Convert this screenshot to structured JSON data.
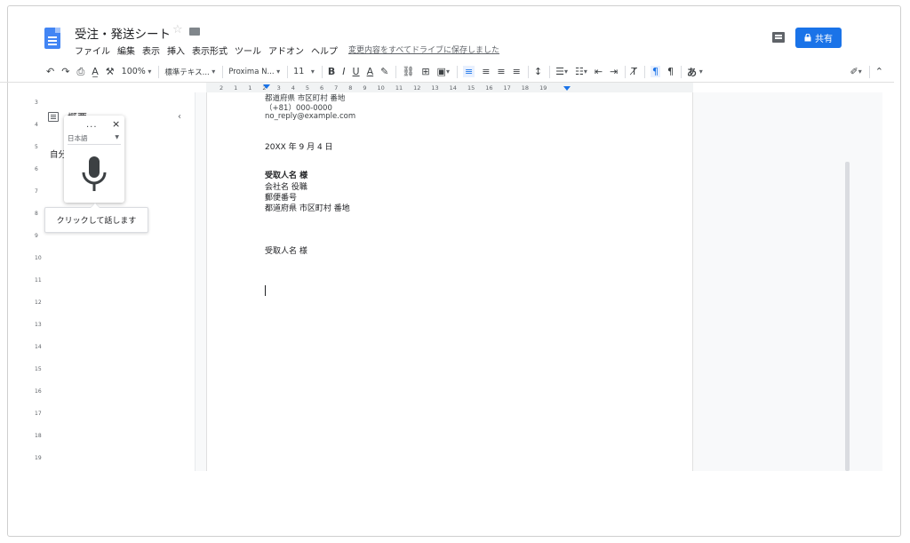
{
  "header": {
    "doc_title": "受注・発送シート",
    "menu": [
      "ファイル",
      "編集",
      "表示",
      "挿入",
      "表示形式",
      "ツール",
      "アドオン",
      "ヘルプ"
    ],
    "save_status": "変更内容をすべてドライブに保存しました",
    "share_label": "共有",
    "share_icon": "lock-icon",
    "colors": {
      "brand_blue": "#1a73e8",
      "doc_blue": "#4285f4"
    }
  },
  "toolbar": {
    "zoom": "100%",
    "style": "標準テキス...",
    "font": "Proxima N...",
    "font_size": "11",
    "bold": "B",
    "italic": "I",
    "underline": "U",
    "text_color": "A",
    "input_tool": "あ"
  },
  "ruler": {
    "marks": [
      "2",
      "1",
      "1",
      "2",
      "3",
      "4",
      "5",
      "6",
      "7",
      "8",
      "9",
      "10",
      "11",
      "12",
      "13",
      "14",
      "15",
      "16",
      "17",
      "18",
      "19"
    ]
  },
  "vertical_ruler": {
    "marks": [
      "3",
      "4",
      "5",
      "6",
      "7",
      "8",
      "9",
      "10",
      "11",
      "12",
      "13",
      "14",
      "15",
      "16",
      "17",
      "18",
      "19"
    ]
  },
  "outline": {
    "title": "概要",
    "item": "自分"
  },
  "voice_typing": {
    "menu_label": "...",
    "close_label": "×",
    "language": "日本語",
    "tooltip": "クリックして話します"
  },
  "document": {
    "lines": [
      {
        "text": "都道府県 市区町村 番地",
        "style": "small"
      },
      {
        "text": "（+81）000-0000",
        "style": "small"
      },
      {
        "text": "no_reply@example.com",
        "style": "small"
      },
      {
        "text": "20XX 年 9 月 4 日",
        "style": "normal"
      },
      {
        "text": "受取人名 様",
        "style": "bold"
      },
      {
        "text": "会社名 役職",
        "style": "normal"
      },
      {
        "text": "郵便番号",
        "style": "normal"
      },
      {
        "text": "都道府県 市区町村 番地",
        "style": "normal"
      },
      {
        "text": "受取人名 様",
        "style": "normal"
      }
    ]
  }
}
